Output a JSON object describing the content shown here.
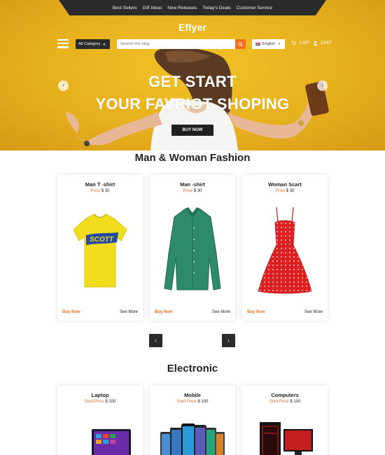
{
  "topnav": {
    "items": [
      "Best Sellers",
      "Gift Ideas",
      "New Releases",
      "Today's Deals",
      "Customer Service"
    ]
  },
  "header": {
    "logo": "Eflyer",
    "category_label": "All Category",
    "search": {
      "placeholder": "Search this blog",
      "value": ""
    },
    "language": "English",
    "cart_labels": [
      "CART",
      "CART"
    ]
  },
  "hero": {
    "title_line1": "GET START",
    "title_line2": "YOUR FAVRIOT SHOPING",
    "button": "BUY NOW",
    "background_color": "#e9b51f"
  },
  "fashion": {
    "title": "Man & Woman Fashion",
    "products": [
      {
        "name": "Man T -shirt",
        "price_label": "Price",
        "price": "$ 30",
        "buy": "Buy Now",
        "more": "See More",
        "image": "yellow-tshirt"
      },
      {
        "name": "Man -shirt",
        "price_label": "Price",
        "price": "$ 30",
        "buy": "Buy Now",
        "more": "See More",
        "image": "green-shirt"
      },
      {
        "name": "Woman Scart",
        "price_label": "Price",
        "price": "$ 30",
        "buy": "Buy Now",
        "more": "See More",
        "image": "red-polka-dress"
      }
    ]
  },
  "electronic": {
    "title": "Electronic",
    "products": [
      {
        "name": "Laptop",
        "price_label": "Start Price",
        "price": "$ 100",
        "image": "laptop"
      },
      {
        "name": "Mobile",
        "price_label": "Start Price",
        "price": "$ 100",
        "image": "smartphones"
      },
      {
        "name": "Computers",
        "price_label": "Start Price",
        "price": "$ 100",
        "image": "desktop-pc"
      }
    ]
  },
  "colors": {
    "accent": "#f26e21",
    "dark": "#2b2b2b",
    "hero_yellow": "#e9b51f"
  }
}
